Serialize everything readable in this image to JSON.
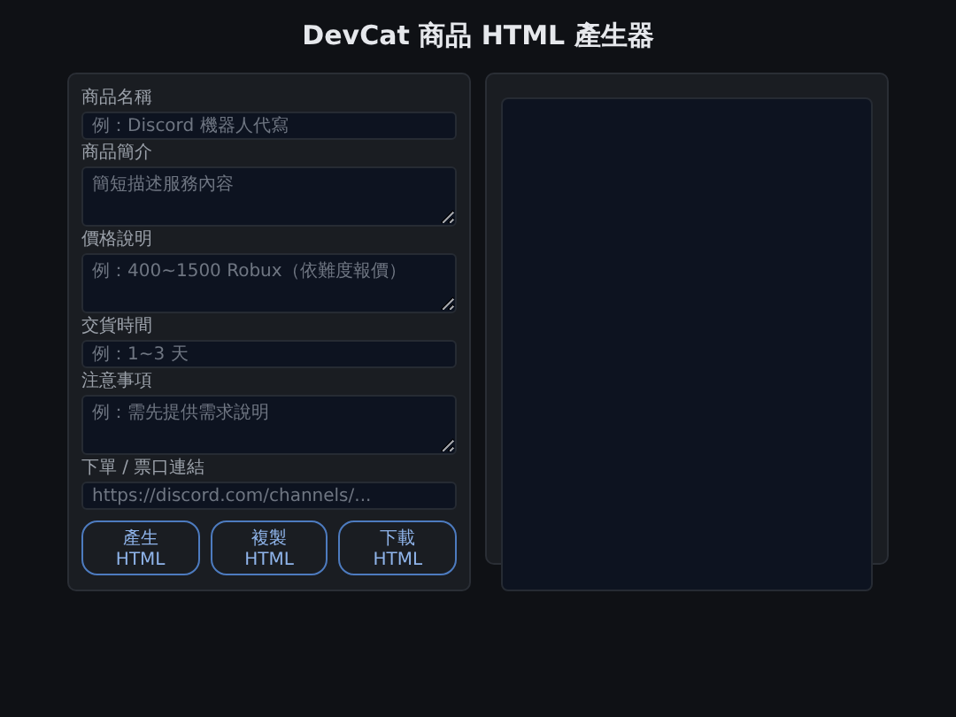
{
  "title": "DevCat 商品 HTML 產生器",
  "form": {
    "fields": [
      {
        "kind": "input",
        "label": "商品名稱",
        "placeholder": "例：Discord 機器人代寫"
      },
      {
        "kind": "textarea",
        "label": "商品簡介",
        "placeholder": "簡短描述服務內容"
      },
      {
        "kind": "textarea",
        "label": "價格說明",
        "placeholder": "例：400~1500 Robux（依難度報價）"
      },
      {
        "kind": "input",
        "label": "交貨時間",
        "placeholder": "例：1~3 天"
      },
      {
        "kind": "textarea",
        "label": "注意事項",
        "placeholder": "例：需先提供需求說明"
      },
      {
        "kind": "input",
        "label": "下單 / 票口連結",
        "placeholder": "https://discord.com/channels/..."
      }
    ],
    "buttons": [
      "產生 HTML",
      "複製 HTML",
      "下載 HTML"
    ]
  }
}
